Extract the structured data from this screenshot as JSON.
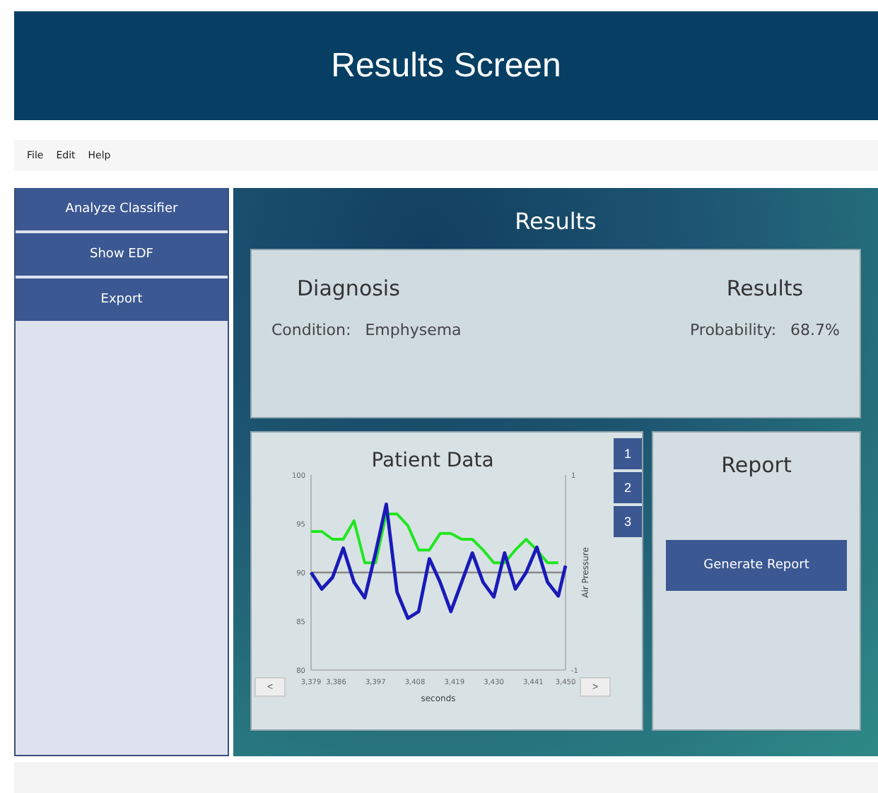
{
  "header": {
    "title": "Results Screen"
  },
  "menu": [
    "File",
    "Edit",
    "Help"
  ],
  "sidebar": {
    "items": [
      {
        "label": "Analyze Classifier"
      },
      {
        "label": "Show EDF"
      },
      {
        "label": "Export"
      }
    ]
  },
  "content": {
    "title": "Results",
    "summary": {
      "left_heading": "Diagnosis",
      "left_label": "Condition:",
      "left_value": "Emphysema",
      "right_heading": "Results",
      "right_label": "Probability:",
      "right_value": "68.7%"
    },
    "patient_data": {
      "title": "Patient Data",
      "tabs": [
        {
          "label": "1",
          "selected": false
        },
        {
          "label": "2",
          "selected": false
        },
        {
          "label": "3",
          "selected": false
        }
      ],
      "prev": "<",
      "next": ">",
      "chart_data": {
        "type": "line",
        "xlabel": "seconds",
        "ylabel": "Air Pressure",
        "x": [
          3379,
          3382,
          3385,
          3388,
          3391,
          3394,
          3397,
          3400,
          3403,
          3406,
          3409,
          3412,
          3415,
          3418,
          3421,
          3424,
          3427,
          3430,
          3433,
          3436,
          3439,
          3442,
          3445,
          3448,
          3450
        ],
        "series": [
          {
            "color": "#22e622",
            "values": [
              94.2,
              94.2,
              93.4,
              93.4,
              95.3,
              91,
              91,
              96,
              96,
              94.8,
              92.3,
              92.3,
              94,
              94,
              93.4,
              93.4,
              92.3,
              91,
              91,
              92.3,
              93.4,
              92.3,
              91,
              91,
              null
            ]
          },
          {
            "color": "#1a1ab8",
            "values": [
              90,
              88.3,
              89.5,
              92.5,
              89,
              87.4,
              92,
              97,
              88,
              85.3,
              86,
              91.4,
              89,
              86,
              89,
              92,
              89,
              87.5,
              92,
              88.3,
              90,
              92.6,
              89,
              87.6,
              90.7
            ]
          }
        ],
        "xlim": [
          3379,
          3450
        ],
        "ylim": [
          80,
          100
        ],
        "xticks": [
          {
            "value": 3379,
            "label": "3,379"
          },
          {
            "value": 3386,
            "label": "3,386"
          },
          {
            "value": 3397,
            "label": "3,397"
          },
          {
            "value": 3408,
            "label": "3,408"
          },
          {
            "value": 3419,
            "label": "3,419"
          },
          {
            "value": 3430,
            "label": "3,430"
          },
          {
            "value": 3441,
            "label": "3,441"
          },
          {
            "value": 3450,
            "label": "3,450"
          }
        ],
        "yticks": [
          80,
          85,
          90,
          95,
          100
        ]
      },
      "right_axis_ticks": [
        "1",
        "-1"
      ]
    },
    "report": {
      "title": "Report",
      "button": "Generate Report"
    }
  }
}
